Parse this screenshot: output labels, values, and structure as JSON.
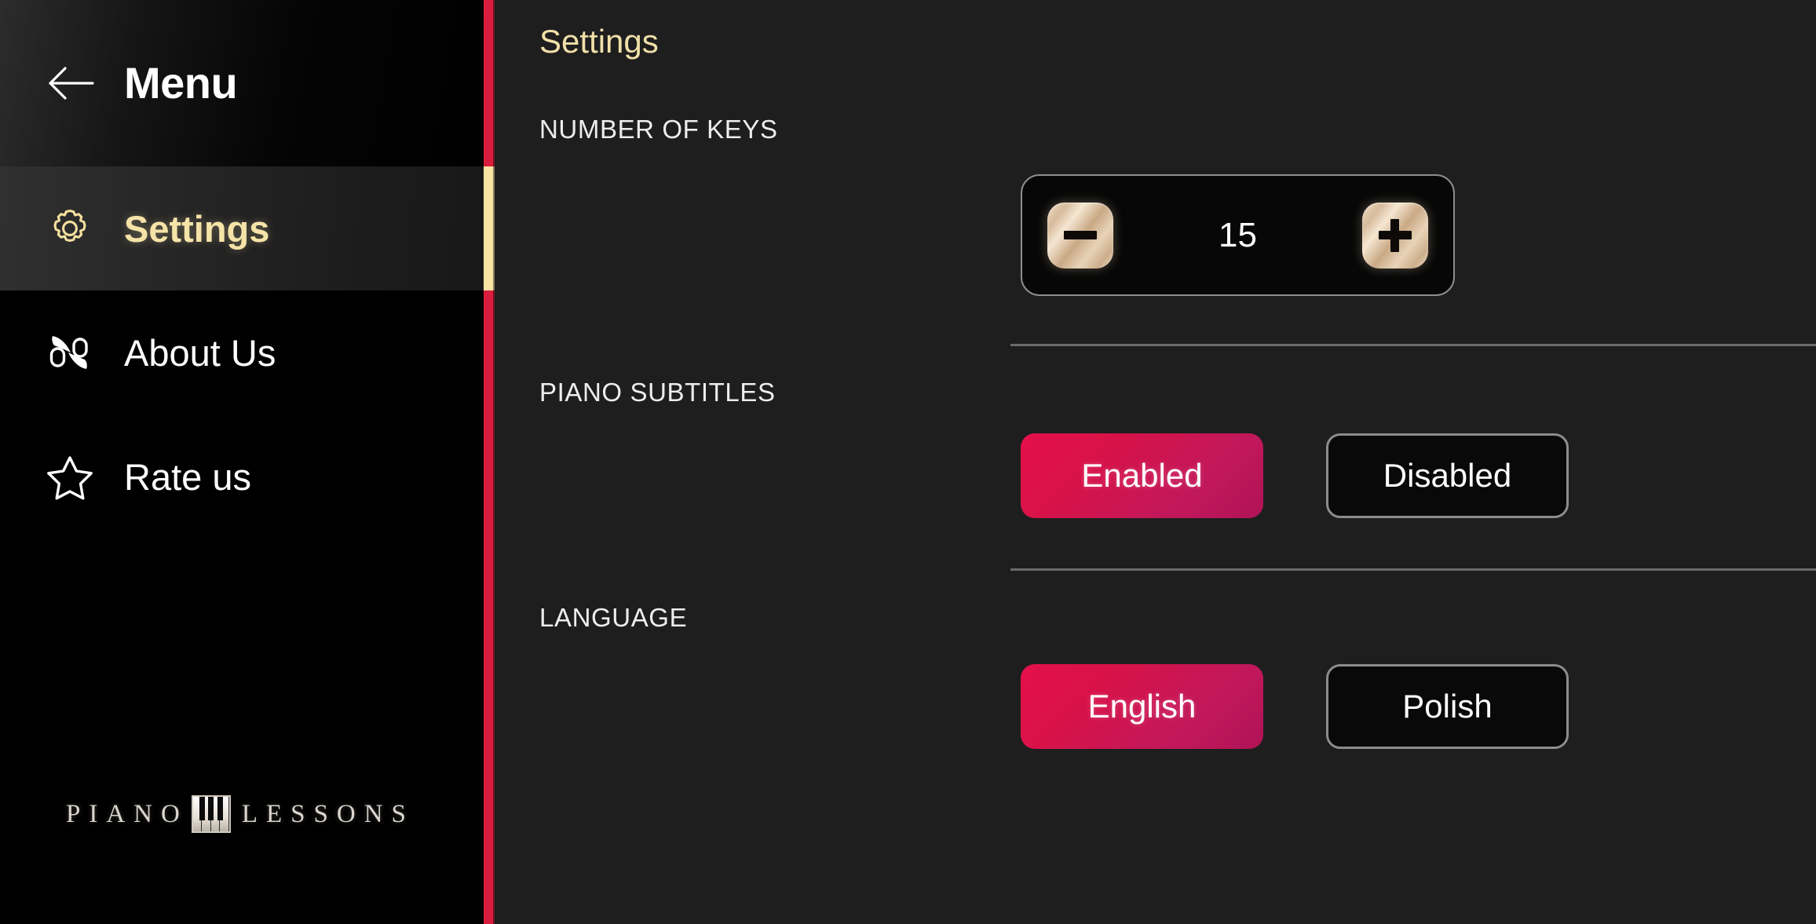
{
  "sidebar": {
    "back_icon": "arrow-left-icon",
    "title": "Menu",
    "items": [
      {
        "label": "Settings",
        "icon": "gear-icon",
        "selected": true
      },
      {
        "label": "About Us",
        "icon": "double-music-note-icon",
        "selected": false
      },
      {
        "label": "Rate us",
        "icon": "star-outline-icon",
        "selected": false
      }
    ],
    "brand": {
      "word_left": "PIANO",
      "word_right": "LESSONS",
      "icon": "piano-keys-icon"
    }
  },
  "content": {
    "title": "Settings",
    "sections": {
      "keys": {
        "label": "NUMBER OF KEYS",
        "value": "15",
        "decrement_icon": "minus-icon",
        "increment_icon": "plus-icon"
      },
      "subtitles": {
        "label": "PIANO SUBTITLES",
        "options": [
          {
            "label": "Enabled",
            "active": true
          },
          {
            "label": "Disabled",
            "active": false
          }
        ]
      },
      "language": {
        "label": "LANGUAGE",
        "options": [
          {
            "label": "English",
            "active": true
          },
          {
            "label": "Polish",
            "active": false
          }
        ]
      }
    }
  },
  "colors": {
    "accent_red": "#d81e3c",
    "accent_gold": "#f8e2a4",
    "button_active": "#d81248",
    "sidebar_bg": "#000000",
    "content_bg": "#1e1e1e",
    "title_gold": "#f0dfa8"
  }
}
